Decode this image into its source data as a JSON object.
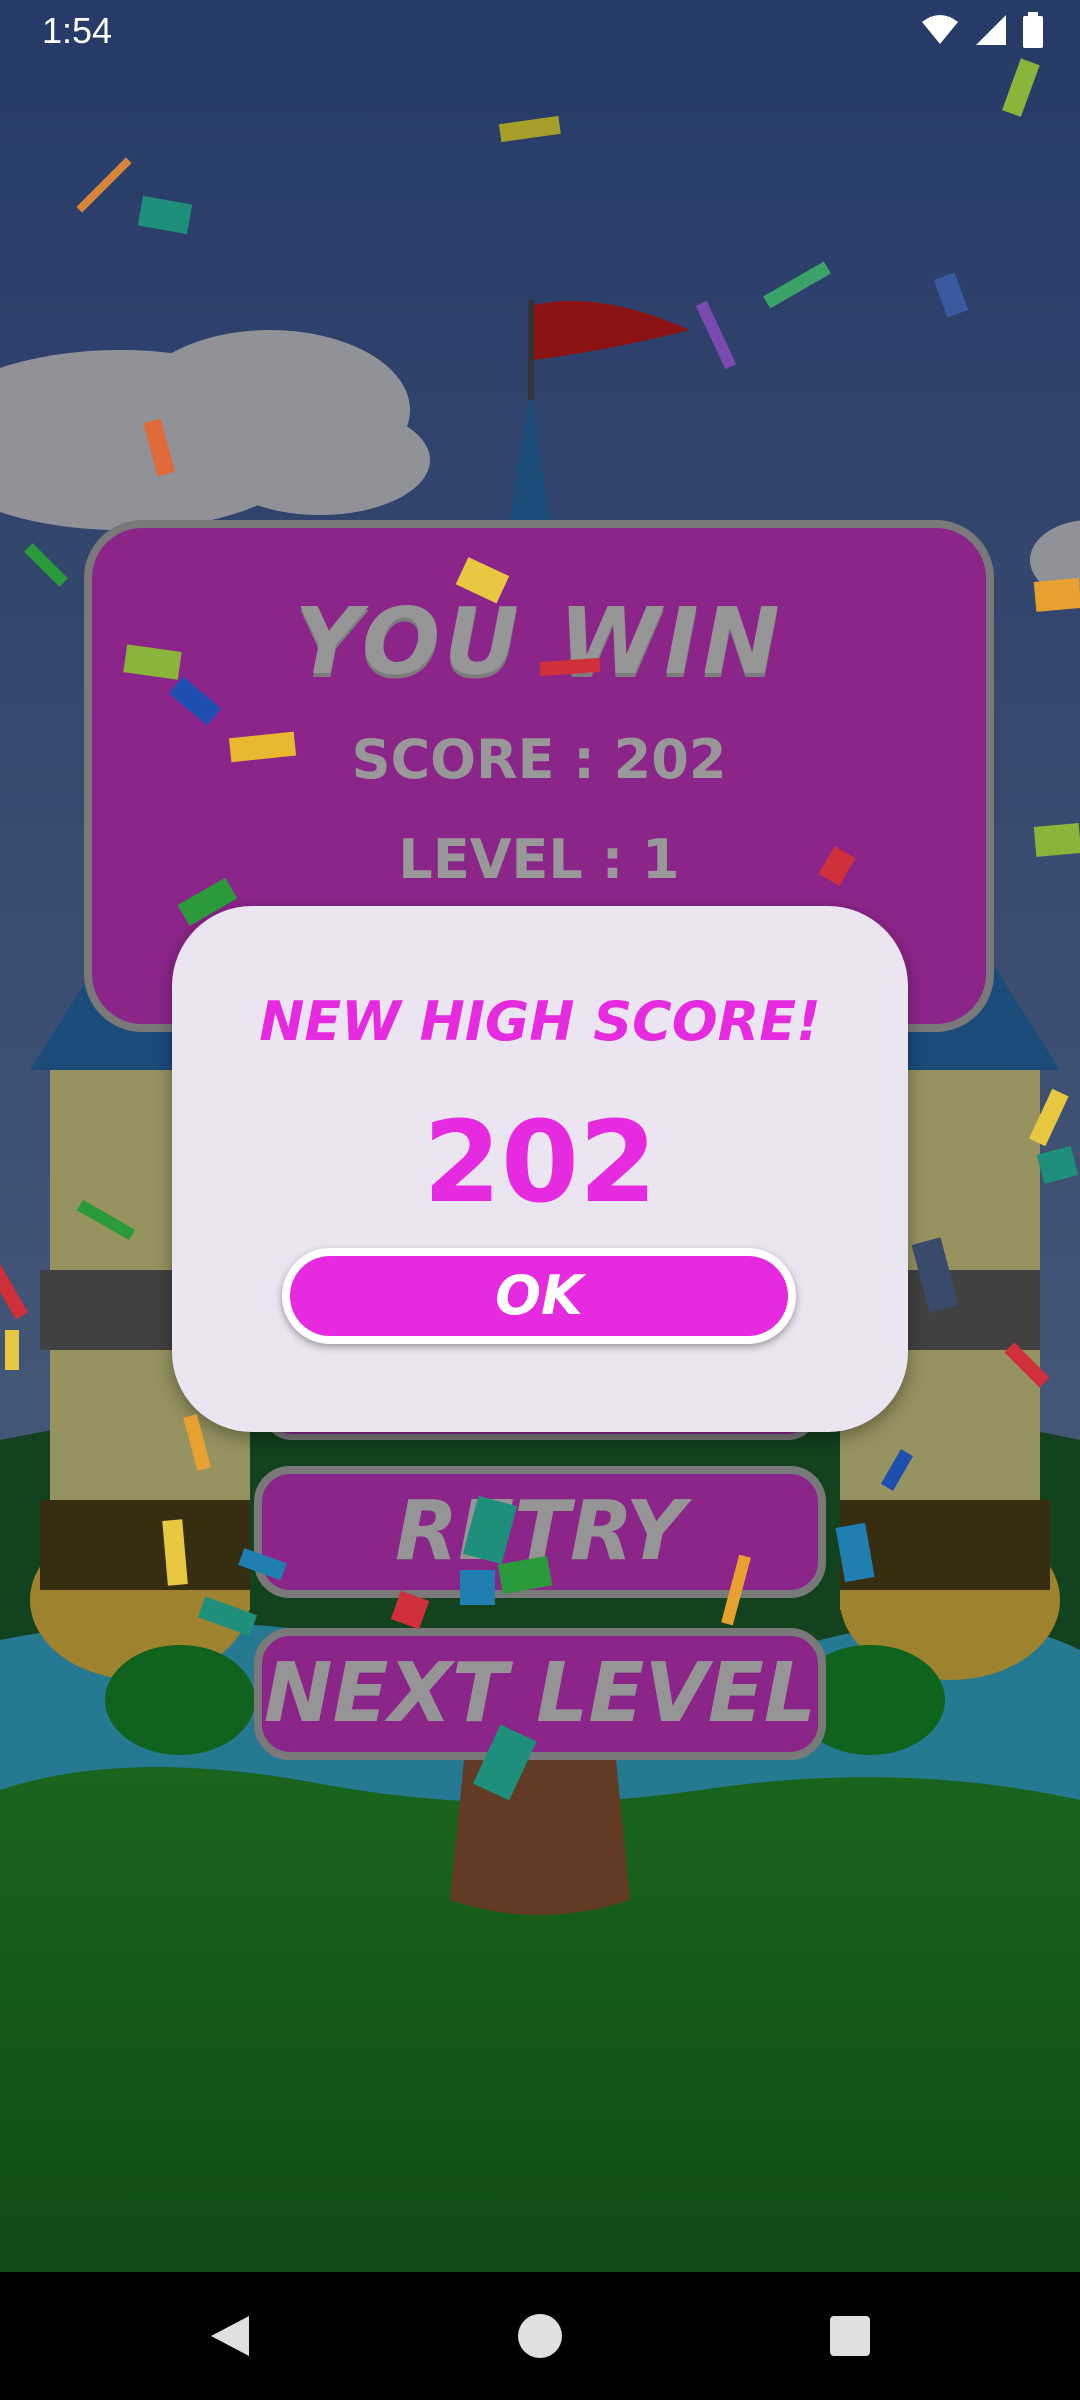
{
  "status_bar": {
    "time": "1:54",
    "icons": [
      "wifi-icon",
      "signal-icon",
      "battery-icon"
    ]
  },
  "win_panel": {
    "title": "YOU WIN",
    "score_text": "SCORE : 202",
    "level_text": "LEVEL : 1"
  },
  "buttons": {
    "retry_label": "RETRY",
    "next_level_label": "NEXT LEVEL"
  },
  "dialog": {
    "title": "NEW HIGH SCORE!",
    "score": "202",
    "ok_label": "OK"
  },
  "nav_bar": {
    "icons": [
      "back-icon",
      "home-icon",
      "recents-icon"
    ]
  },
  "colors": {
    "sky": "#4d6fb4",
    "grass": "#1f8c28",
    "panel_magenta": "#e23cdf",
    "dialog_bg": "#ebe5f2",
    "accent": "#e52ae0"
  }
}
